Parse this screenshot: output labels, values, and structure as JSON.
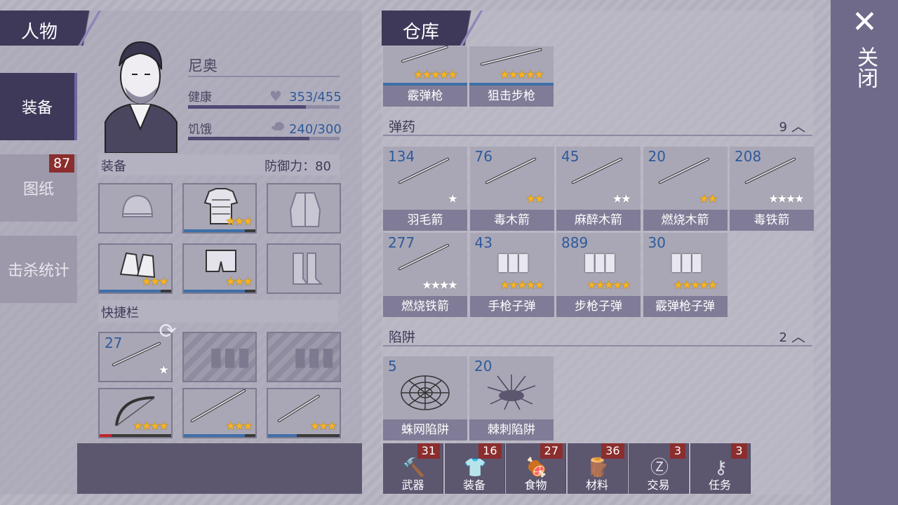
{
  "character_panel": {
    "title": "人物",
    "tabs": [
      {
        "label": "装备"
      },
      {
        "label": "图纸",
        "badge": "87"
      },
      {
        "label": "击杀统计"
      }
    ],
    "name": "尼奥",
    "health_label": "健康",
    "health_value": "353/455",
    "health_fraction": 0.776,
    "hunger_label": "饥饿",
    "hunger_value": "240/300",
    "hunger_fraction": 0.8,
    "equipment_label": "装备",
    "defense_label": "防御力：80",
    "equipment_slots": [
      {
        "icon": "helmet-icon",
        "stars": 0
      },
      {
        "icon": "armor-vest-icon",
        "stars": 3
      },
      {
        "icon": "jacket-icon",
        "stars": 0
      },
      {
        "icon": "gloves-icon",
        "stars": 3
      },
      {
        "icon": "pants-icon",
        "stars": 3
      },
      {
        "icon": "boots-icon",
        "stars": 0
      }
    ],
    "quickbar_label": "快捷栏",
    "quickbar_slots": [
      {
        "icon": "arrow-icon",
        "count": "27",
        "stars": 1,
        "stars_white": true
      },
      {
        "icon": "ammo-placeholder-icon",
        "count": "",
        "stars": 0
      },
      {
        "icon": "ammo-placeholder-icon",
        "count": "",
        "stars": 0
      },
      {
        "icon": "bow-icon",
        "count": "",
        "stars": 4
      },
      {
        "icon": "spear-icon",
        "count": "",
        "stars": 3
      },
      {
        "icon": "axe-icon",
        "count": "",
        "stars": 3
      }
    ]
  },
  "warehouse": {
    "title": "仓库",
    "weapons": [
      {
        "label": "霰弹枪",
        "stars": 5
      },
      {
        "label": "狙击步枪",
        "stars": 5
      }
    ],
    "ammo_section": {
      "label": "弹药",
      "count": "9"
    },
    "ammo": [
      {
        "count": "134",
        "label": "羽毛箭",
        "gold": 0,
        "white": 1
      },
      {
        "count": "76",
        "label": "毒木箭",
        "gold": 2,
        "white": 0
      },
      {
        "count": "45",
        "label": "麻醉木箭",
        "gold": 0,
        "white": 2
      },
      {
        "count": "20",
        "label": "燃烧木箭",
        "gold": 2,
        "white": 0
      },
      {
        "count": "208",
        "label": "毒铁箭",
        "gold": 0,
        "white": 4
      },
      {
        "count": "277",
        "label": "燃烧铁箭",
        "gold": 0,
        "white": 4
      },
      {
        "count": "43",
        "label": "手枪子弹",
        "gold": 5,
        "white": 0
      },
      {
        "count": "889",
        "label": "步枪子弹",
        "gold": 5,
        "white": 0
      },
      {
        "count": "30",
        "label": "霰弹枪子弹",
        "gold": 5,
        "white": 0
      }
    ],
    "trap_section": {
      "label": "陷阱",
      "count": "2"
    },
    "traps": [
      {
        "count": "5",
        "label": "蛛网陷阱"
      },
      {
        "count": "20",
        "label": "棘刺陷阱"
      }
    ],
    "bottom_tabs": [
      {
        "label": "武器",
        "badge": "31",
        "icon": "weapon-icon"
      },
      {
        "label": "装备",
        "badge": "16",
        "icon": "shirt-icon"
      },
      {
        "label": "食物",
        "badge": "27",
        "icon": "meat-icon"
      },
      {
        "label": "材料",
        "badge": "36",
        "icon": "log-icon"
      },
      {
        "label": "交易",
        "badge": "3",
        "icon": "coin-icon"
      },
      {
        "label": "任务",
        "badge": "3",
        "icon": "key-icon"
      }
    ]
  },
  "close_label": "关闭",
  "colors": {
    "panel_dark": "#3e3958",
    "bar_blue": "#3f6fa8",
    "badge_red": "#8b2e2e",
    "star_gold": "#f6b423"
  }
}
